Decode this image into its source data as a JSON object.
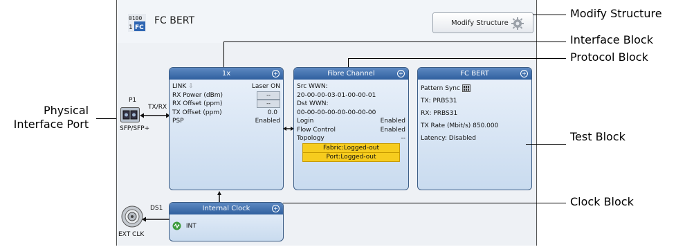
{
  "app": {
    "title": "FC BERT",
    "modify_button": "Modify Structure"
  },
  "interface_block": {
    "title": "1x",
    "rows": [
      {
        "label": "LINK",
        "value": "Laser ON"
      },
      {
        "label": "RX Power (dBm)",
        "value": "--"
      },
      {
        "label": "RX Offset (ppm)",
        "value": "--"
      },
      {
        "label": "TX Offset (ppm)",
        "value": "0.0"
      },
      {
        "label": "PSP",
        "value": "Enabled"
      }
    ]
  },
  "protocol_block": {
    "title": "Fibre Channel",
    "src_label": "Src WWN:",
    "src_value": "20-00-00-03-01-00-00-01",
    "dst_label": "Dst WWN:",
    "dst_value": "00-00-00-00-00-00-00-00",
    "rows": [
      {
        "label": "Login",
        "value": "Enabled"
      },
      {
        "label": "Flow Control",
        "value": "Enabled"
      },
      {
        "label": "Topology",
        "value": "--"
      }
    ],
    "status": [
      "Fabric:Logged-out",
      "Port:Logged-out"
    ]
  },
  "test_block": {
    "title": "FC BERT",
    "rows": [
      "Pattern Sync",
      "TX:  PRBS31",
      "RX:  PRBS31",
      "TX Rate (Mbit/s)  850.000",
      "Latency:  Disabled"
    ]
  },
  "clock_block": {
    "title": "Internal Clock",
    "value": "INT"
  },
  "port": {
    "name": "P1",
    "direction": "TX/RX",
    "type": "SFP/SFP+"
  },
  "ext_clock": {
    "name": "DS1",
    "label": "EXT CLK"
  },
  "callouts": {
    "modify": "Modify Structure",
    "interface": "Interface Block",
    "protocol": "Protocol Block",
    "test": "Test Block",
    "clock": "Clock Block",
    "physical_line1": "Physical",
    "physical_line2": "Interface Port"
  }
}
